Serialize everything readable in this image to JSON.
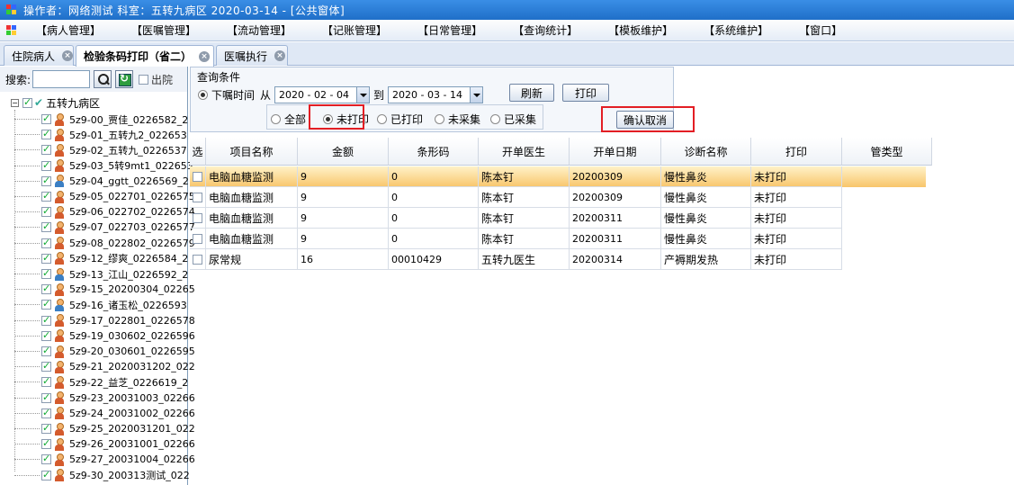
{
  "window": {
    "title": "操作者：网络测试  科室：五转九病区  2020-03-14  - [公共窗体]"
  },
  "menu": [
    "【病人管理】",
    "【医嘱管理】",
    "【流动管理】",
    "【记账管理】",
    "【日常管理】",
    "【查询统计】",
    "【模板维护】",
    "【系统维护】",
    "【窗口】"
  ],
  "tabs": [
    {
      "label": "住院病人"
    },
    {
      "label": "检验条码打印（省二）"
    },
    {
      "label": "医嘱执行"
    }
  ],
  "left": {
    "search_label": "搜索:",
    "search_value": "",
    "discharge_label": "出院",
    "root_label": "五转九病区",
    "patients": [
      "5z9-00_贾佳_0226582_2",
      "5z9-01_五转九2_022653",
      "5z9-02_五转九_0226537",
      "5z9-03_5转9mt1_022653",
      "5z9-04_ggtt_0226569_2",
      "5z9-05_022701_0226575",
      "5z9-06_022702_0226574",
      "5z9-07_022703_0226577",
      "5z9-08_022802_0226579",
      "5z9-12_缪爽_0226584_2",
      "5z9-13_江山_0226592_2",
      "5z9-15_20200304_02265",
      "5z9-16_诸玉松_0226593",
      "5z9-17_022801_0226578",
      "5z9-19_030602_0226596",
      "5z9-20_030601_0226595",
      "5z9-21_2020031202_022",
      "5z9-22_益芝_0226619_2",
      "5z9-23_20031003_02266",
      "5z9-24_20031002_02266",
      "5z9-25_2020031201_022",
      "5z9-26_20031001_02266",
      "5z9-27_20031004_02266",
      "5z9-30_200313测试_022"
    ],
    "male_indices": [
      4,
      10,
      12
    ]
  },
  "query": {
    "title": "查询条件",
    "order_time_label": "下嘱时间",
    "from_label": "从",
    "from_date": "2020 - 02 - 04",
    "to_label": "到",
    "to_date": "2020 - 03 - 14",
    "refresh_label": "刷新",
    "print_label": "打印",
    "status_options": [
      "全部",
      "未打印",
      "已打印",
      "未采集",
      "已采集"
    ],
    "selected_status": "未打印",
    "confirm_cancel_label": "确认取消"
  },
  "grid": {
    "columns": [
      "选",
      "项目名称",
      "金额",
      "条形码",
      "开单医生",
      "开单日期",
      "诊断名称",
      "打印",
      "管类型"
    ],
    "rows": [
      [
        "",
        "电脑血糖监测",
        "9",
        "0",
        "陈本钉",
        "20200309",
        "慢性鼻炎",
        "未打印",
        ""
      ],
      [
        "",
        "电脑血糖监测",
        "9",
        "0",
        "陈本钉",
        "20200309",
        "慢性鼻炎",
        "未打印",
        ""
      ],
      [
        "",
        "电脑血糖监测",
        "9",
        "0",
        "陈本钉",
        "20200311",
        "慢性鼻炎",
        "未打印",
        ""
      ],
      [
        "",
        "电脑血糖监测",
        "9",
        "0",
        "陈本钉",
        "20200311",
        "慢性鼻炎",
        "未打印",
        ""
      ],
      [
        "",
        "尿常规",
        "16",
        "00010429",
        "五转九医生",
        "20200314",
        "产褥期发热",
        "未打印",
        ""
      ]
    ],
    "selected_row": 0
  },
  "colors": {
    "titlebar": "#1f6fc8",
    "highlight_border": "#e31e24",
    "selected_row": "#f8c56b"
  }
}
